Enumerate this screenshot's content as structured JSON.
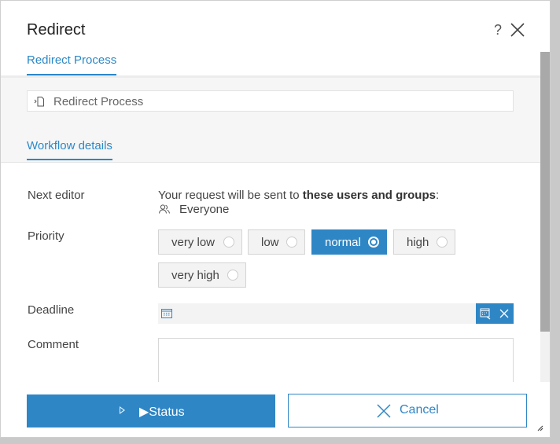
{
  "dialog": {
    "title": "Redirect",
    "help_label": "?",
    "close_icon": "close-icon"
  },
  "tabs": {
    "process_tab": "Redirect Process",
    "workflow_tab": "Workflow details"
  },
  "process_field": {
    "icon": "document-icon",
    "value": "Redirect Process"
  },
  "form": {
    "next_editor_label": "Next editor",
    "info_prefix": "Your request will be sent to ",
    "info_bold": "these users and groups",
    "info_suffix": ":",
    "recipient": "Everyone",
    "priority_label": "Priority",
    "priority_options": [
      "very low",
      "low",
      "normal",
      "high",
      "very high"
    ],
    "priority_selected": "normal",
    "deadline_label": "Deadline",
    "deadline_value": "",
    "comment_label": "Comment",
    "comment_value": ""
  },
  "footer": {
    "status_label": "▶Status",
    "cancel_label": "Cancel"
  },
  "colors": {
    "accent": "#2f86c5",
    "link": "#2b88c8"
  }
}
